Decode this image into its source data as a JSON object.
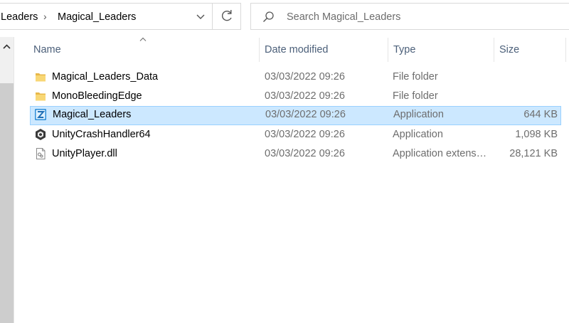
{
  "breadcrumb": {
    "items": [
      "Leaders",
      "Magical_Leaders"
    ],
    "separator": "›"
  },
  "search": {
    "placeholder": "Search Magical_Leaders"
  },
  "columns": {
    "name": "Name",
    "date_modified": "Date modified",
    "type": "Type",
    "size": "Size"
  },
  "files": [
    {
      "name": "Magical_Leaders_Data",
      "date": "03/03/2022 09:26",
      "type": "File folder",
      "size": "",
      "icon": "folder-icon"
    },
    {
      "name": "MonoBleedingEdge",
      "date": "03/03/2022 09:26",
      "type": "File folder",
      "size": "",
      "icon": "folder-icon"
    },
    {
      "name": "Magical_Leaders",
      "date": "03/03/2022 09:26",
      "type": "Application",
      "size": "644 KB",
      "icon": "app-z-icon",
      "selected": true
    },
    {
      "name": "UnityCrashHandler64",
      "date": "03/03/2022 09:26",
      "type": "Application",
      "size": "1,098 KB",
      "icon": "unity-icon"
    },
    {
      "name": "UnityPlayer.dll",
      "date": "03/03/2022 09:26",
      "type": "Application extens…",
      "size": "28,121 KB",
      "icon": "dll-file-icon"
    }
  ],
  "colors": {
    "selection_bg": "#cce8ff",
    "selection_border": "#99d1ff",
    "header_text": "#4c607a",
    "secondary_text": "#6d6d6d",
    "folder": "#f8d775"
  }
}
